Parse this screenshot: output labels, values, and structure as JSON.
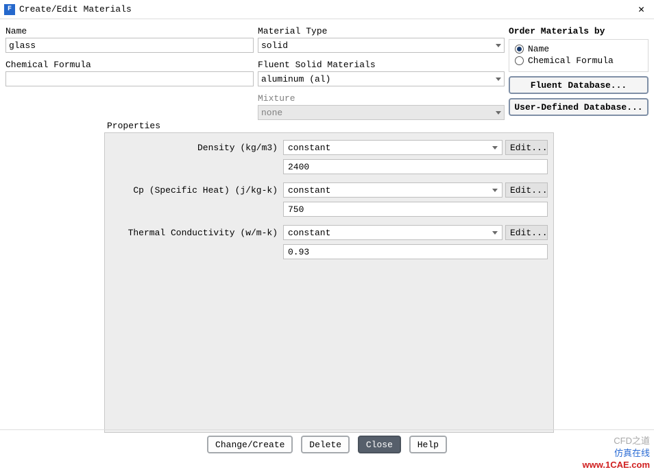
{
  "title": "Create/Edit Materials",
  "fields": {
    "name": {
      "label": "Name",
      "value": "glass"
    },
    "chemical_formula": {
      "label": "Chemical Formula",
      "value": ""
    },
    "material_type": {
      "label": "Material Type",
      "selected": "solid"
    },
    "fluent_solid_materials": {
      "label": "Fluent Solid Materials",
      "selected": "aluminum (al)"
    },
    "mixture": {
      "label": "Mixture",
      "selected": "none",
      "enabled": false
    }
  },
  "order_by": {
    "title": "Order Materials by",
    "options": [
      "Name",
      "Chemical Formula"
    ],
    "selected": "Name"
  },
  "side_buttons": {
    "fluent_db": "Fluent Database...",
    "user_db": "User-Defined Database..."
  },
  "properties": {
    "title": "Properties",
    "edit_label": "Edit...",
    "items": [
      {
        "label": "Density (kg/m3)",
        "method": "constant",
        "value": "2400"
      },
      {
        "label": "Cp (Specific Heat) (j/kg-k)",
        "method": "constant",
        "value": "750"
      },
      {
        "label": "Thermal Conductivity (w/m-k)",
        "method": "constant",
        "value": "0.93"
      }
    ]
  },
  "bottom_buttons": {
    "change_create": "Change/Create",
    "delete": "Delete",
    "close": "Close",
    "help": "Help"
  },
  "watermark": {
    "line1": "CFD之道",
    "line2": "仿真在线",
    "line3": "www.1CAE.com"
  }
}
